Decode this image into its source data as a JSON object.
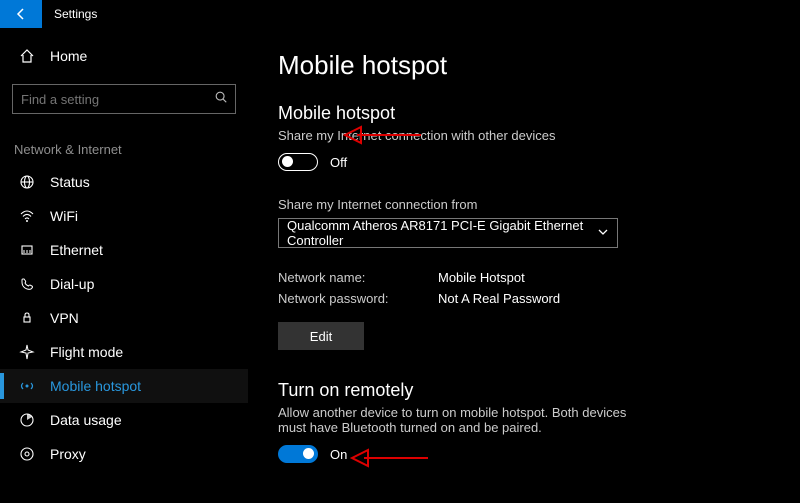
{
  "app": {
    "title": "Settings"
  },
  "sidebar": {
    "home": "Home",
    "search_placeholder": "Find a setting",
    "category": "Network & Internet",
    "items": [
      {
        "label": "Status"
      },
      {
        "label": "WiFi"
      },
      {
        "label": "Ethernet"
      },
      {
        "label": "Dial-up"
      },
      {
        "label": "VPN"
      },
      {
        "label": "Flight mode"
      },
      {
        "label": "Mobile hotspot"
      },
      {
        "label": "Data usage"
      },
      {
        "label": "Proxy"
      }
    ]
  },
  "main": {
    "title": "Mobile hotspot",
    "hotspot": {
      "heading": "Mobile hotspot",
      "desc": "Share my Internet connection with other devices",
      "state": "Off"
    },
    "share_from": {
      "label": "Share my Internet connection from",
      "value": "Qualcomm Atheros AR8171 PCI-E Gigabit Ethernet Controller"
    },
    "net": {
      "name_label": "Network name:",
      "name_value": "Mobile Hotspot",
      "pwd_label": "Network password:",
      "pwd_value": "Not A Real Password",
      "edit": "Edit"
    },
    "remote": {
      "heading": "Turn on remotely",
      "desc": "Allow another device to turn on mobile hotspot. Both devices must have Bluetooth turned on and be paired.",
      "state": "On"
    }
  }
}
